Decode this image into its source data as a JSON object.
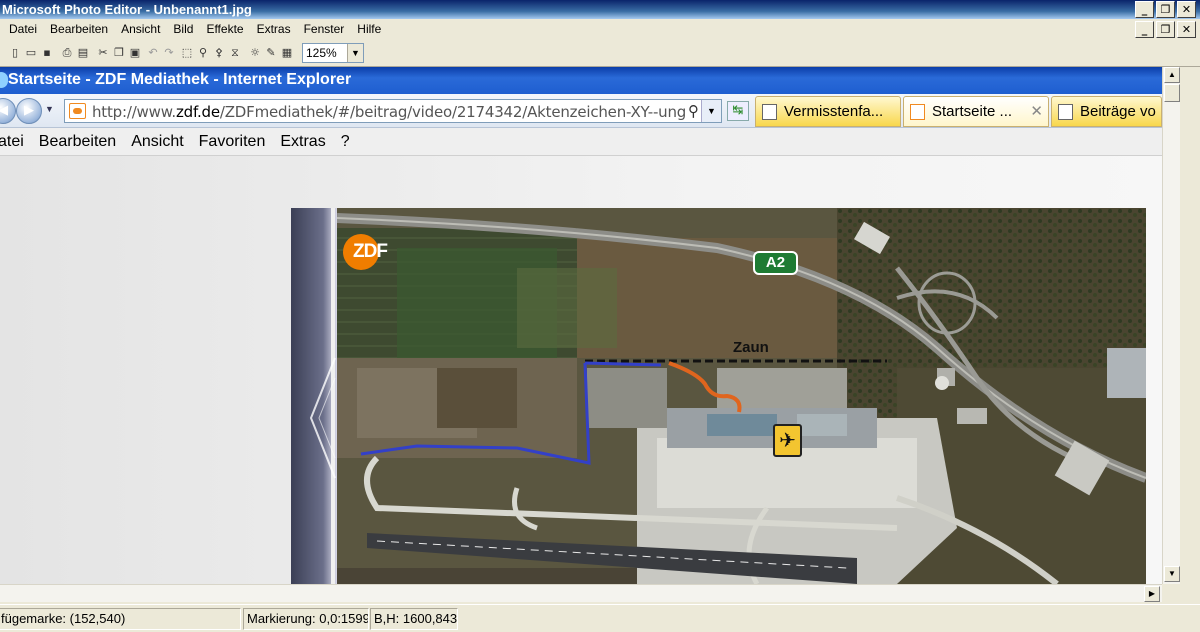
{
  "photo_editor": {
    "title": "Microsoft Photo Editor - Unbenannt1.jpg",
    "menu": [
      "Datei",
      "Bearbeiten",
      "Ansicht",
      "Bild",
      "Effekte",
      "Extras",
      "Fenster",
      "Hilfe"
    ],
    "zoom": "125%"
  },
  "browser": {
    "title": "Startseite - ZDF Mediathek - Internet Explorer",
    "url_prefix": "http://www.",
    "url_domain": "zdf.de",
    "url_rest": "/ZDFmediathek/#/beitrag/video/2174342/Aktenzeichen-XY--ung",
    "tabs": [
      {
        "label": "Vermisstenfa..."
      },
      {
        "label": "Startseite ..."
      },
      {
        "label": "Beiträge vo"
      }
    ],
    "menu": [
      "atei",
      "Bearbeiten",
      "Ansicht",
      "Favoriten",
      "Extras",
      "?"
    ]
  },
  "map": {
    "highway_label": "A2",
    "fence_label": "Zaun",
    "logo": "ZDF"
  },
  "status": {
    "insert_mark": "fügemarke: (152,540)",
    "selection": "Markierung: 0,0:1599,",
    "size": "B,H: 1600,843"
  },
  "icons": {
    "close": "close-icon",
    "maximize": "maximize-icon",
    "minimize": "minimize-icon",
    "airport": "airplane-icon"
  }
}
